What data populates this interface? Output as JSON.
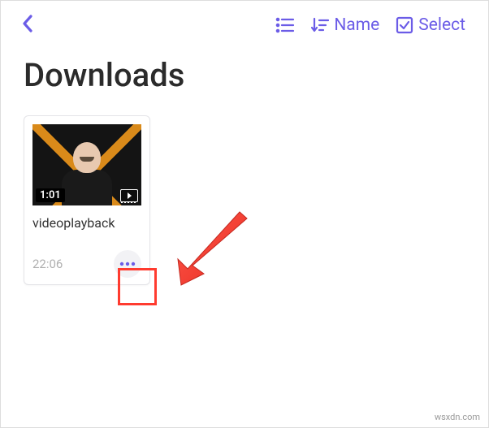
{
  "header": {
    "sort_label": "Name",
    "select_label": "Select"
  },
  "page": {
    "title": "Downloads"
  },
  "files": [
    {
      "name": "videoplayback",
      "duration": "1:01",
      "timestamp": "22:06"
    }
  ],
  "watermark": "wsxdn.com",
  "colors": {
    "accent": "#6b5ce7",
    "annotation": "#ff3b2f"
  }
}
